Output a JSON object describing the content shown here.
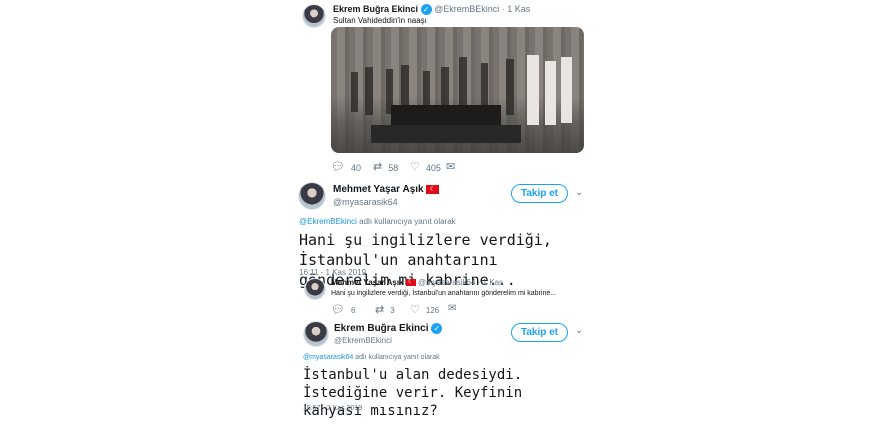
{
  "tweet1": {
    "name": "Ekrem Buğra Ekinci",
    "handle": "@EkremBEkinci",
    "time": "· 1 Kas",
    "text": "Sultan Vahideddin'in naaşı",
    "replies": "40",
    "retweets": "58",
    "likes": "405"
  },
  "tweet2": {
    "name": "Mehmet Yaşar Aşık",
    "handle": "@myasarasik64",
    "follow": "Takip et",
    "reply_to_user": "@EkremBEkinci",
    "reply_to_suffix": "adlı kullanıcıya yanıt olarak",
    "text": "Hani şu ingilizlere verdiği, İstanbul'un anahtarını gönderelim mi kabrine...",
    "timestamp": "16:11 - 1 Kas 2019"
  },
  "tweet3": {
    "name": "Mehmet Yaşar Aşık",
    "handle": "@myasarasik64",
    "time": "· 1 Kas",
    "text": "Hani şu ingilizlere verdiği, İstanbul'un anahtarını gönderelim mi kabrine...",
    "replies": "6",
    "retweets": "3",
    "likes": "126"
  },
  "tweet4": {
    "name": "Ekrem Buğra Ekinci",
    "handle": "@EkremBEkinci",
    "follow": "Takip et",
    "reply_to_user": "@myasarasik64",
    "reply_to_suffix": "adlı kullanıcıya yanıt olarak",
    "text": "İstanbul'u alan dedesiydi. İstediğine verir. Keyfinin kahyası mısınız?",
    "timestamp": "15:57 - 2 Kas 2019"
  },
  "icons": {
    "reply": "speech-bubble",
    "retweet": "retweet-arrows",
    "like": "heart",
    "verified": "verified-badge",
    "flag": "turkey-flag",
    "chevron": "chevron-down"
  }
}
